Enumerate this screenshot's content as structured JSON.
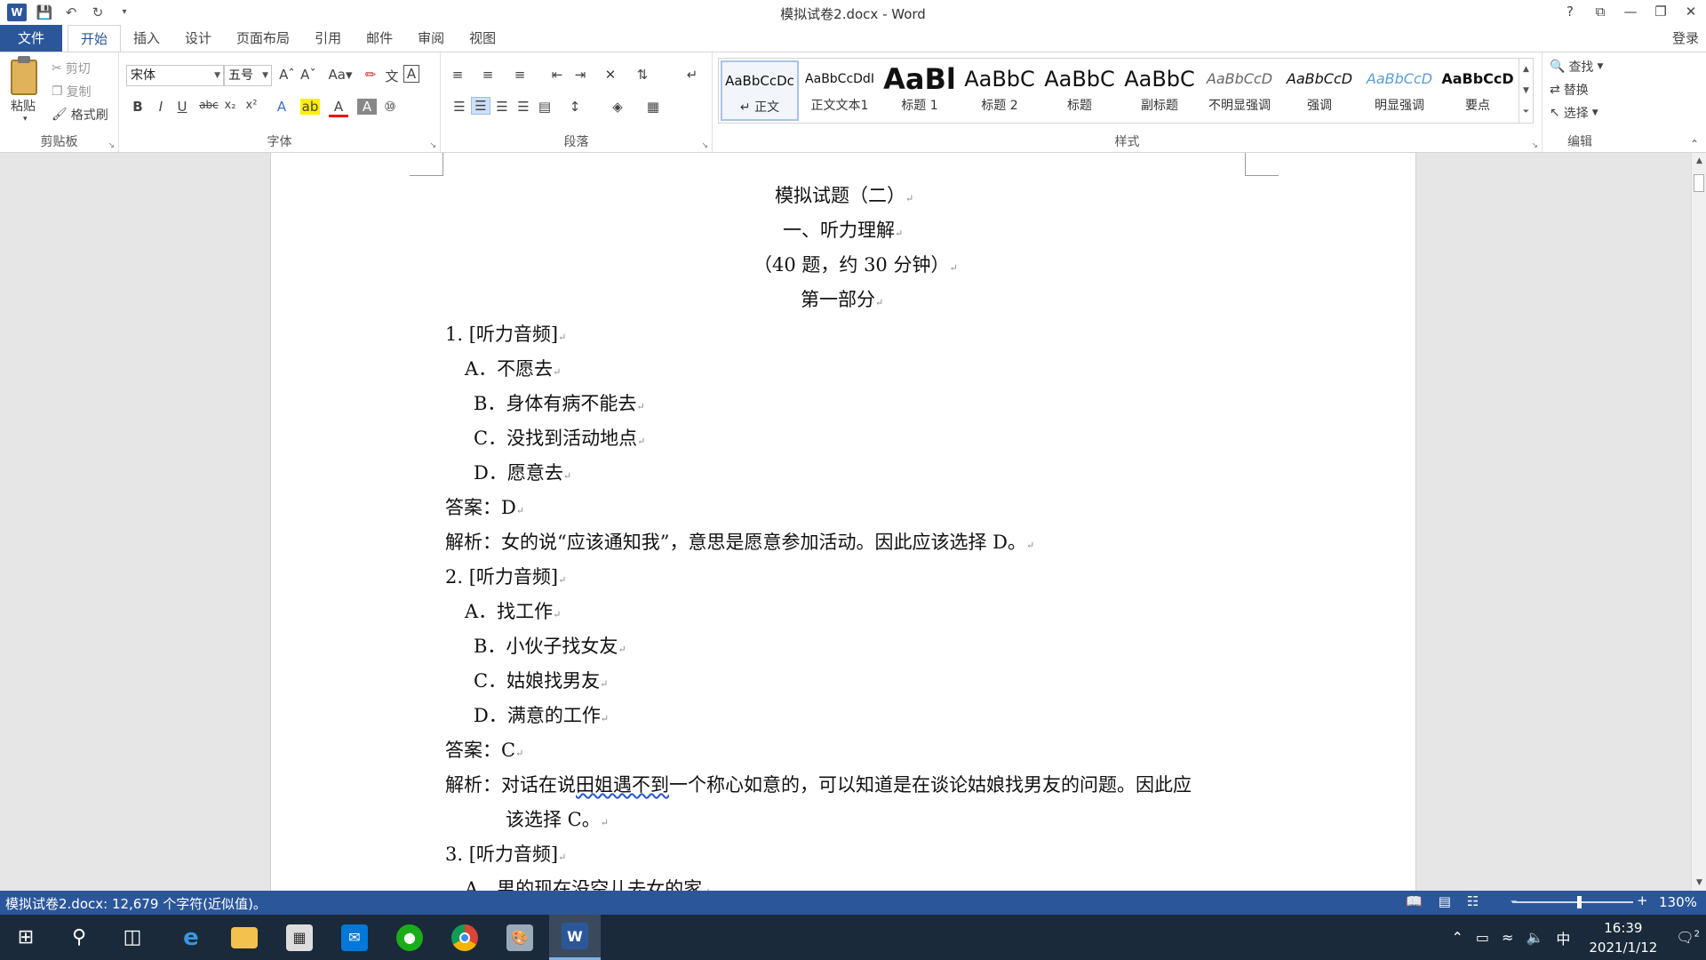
{
  "window": {
    "title": "模拟试卷2.docx - Word"
  },
  "quick_access": {
    "word_icon": "W",
    "save_icon": "save-icon",
    "undo_icon": "undo-icon",
    "redo_icon": "redo-icon"
  },
  "window_controls": [
    "?",
    "⧉",
    "—",
    "❐",
    "✕"
  ],
  "tabs": [
    {
      "label": "文件"
    },
    {
      "label": "开始"
    },
    {
      "label": "插入"
    },
    {
      "label": "设计"
    },
    {
      "label": "页面布局"
    },
    {
      "label": "引用"
    },
    {
      "label": "邮件"
    },
    {
      "label": "审阅"
    },
    {
      "label": "视图"
    }
  ],
  "login": "登录",
  "ribbon": {
    "clipboard": {
      "paste": "粘贴",
      "cut": "剪切",
      "copy": "复制",
      "format_painter": "格式刷",
      "label": "剪贴板"
    },
    "font": {
      "name": "宋体",
      "size": "五号",
      "label": "字体"
    },
    "paragraph": {
      "label": "段落"
    },
    "styles": {
      "label": "样式",
      "items": [
        {
          "preview": "AaBbCcDc",
          "name": "↵ 正文"
        },
        {
          "preview": "AaBbCcDdI",
          "name": "正文文本1"
        },
        {
          "preview": "AaBl",
          "name": "标题 1"
        },
        {
          "preview": "AaBbC",
          "name": "标题 2"
        },
        {
          "preview": "AaBbC",
          "name": "标题"
        },
        {
          "preview": "AaBbC",
          "name": "副标题"
        },
        {
          "preview": "AaBbCcD",
          "name": "不明显强调"
        },
        {
          "preview": "AaBbCcD",
          "name": "强调"
        },
        {
          "preview": "AaBbCcD",
          "name": "明显强调"
        },
        {
          "preview": "AaBbCcD",
          "name": "要点"
        }
      ]
    },
    "editing": {
      "find": "查找",
      "replace": "替换",
      "select": "选择",
      "label": "编辑"
    }
  },
  "document": {
    "lines": [
      {
        "text": "模拟试题（二）"
      },
      {
        "text": "一、听力理解"
      },
      {
        "text": "（40 题，约 30 分钟）"
      },
      {
        "text": "第一部分"
      },
      {
        "text": "1.   [听力音频]"
      },
      {
        "text": "A．不愿去"
      },
      {
        "text": "B．身体有病不能去"
      },
      {
        "text": "C．没找到活动地点"
      },
      {
        "text": "D．愿意去"
      },
      {
        "text": "答案：D"
      },
      {
        "text": "解析：女的说“应该通知我”，意思是愿意参加活动。因此应该选择 D。"
      },
      {
        "text": "2.   [听力音频]"
      },
      {
        "text": "A．找工作"
      },
      {
        "text": "B．小伙子找女友"
      },
      {
        "text": "C．姑娘找男友"
      },
      {
        "text": "D．满意的工作"
      },
      {
        "text": "答案：C"
      },
      {
        "text_pre": "解析：对话在说",
        "text_mark": "田姐遇不到",
        "text_post": "一个称心如意的，可以知道是在谈论姑娘找男友的问题。因此应"
      },
      {
        "text": "该选择 C。"
      },
      {
        "text": "3.   [听力音频]"
      },
      {
        "text": "A．男的现在没空儿去女的家"
      }
    ]
  },
  "status": {
    "left": "模拟试卷2.docx: 12,679 个字符(近似值)。",
    "zoom": "130%"
  },
  "zoom_level": 0.56,
  "taskbar": {
    "time": "16:39",
    "date": "2021/1/12",
    "ime": "中",
    "notifications": "2"
  }
}
